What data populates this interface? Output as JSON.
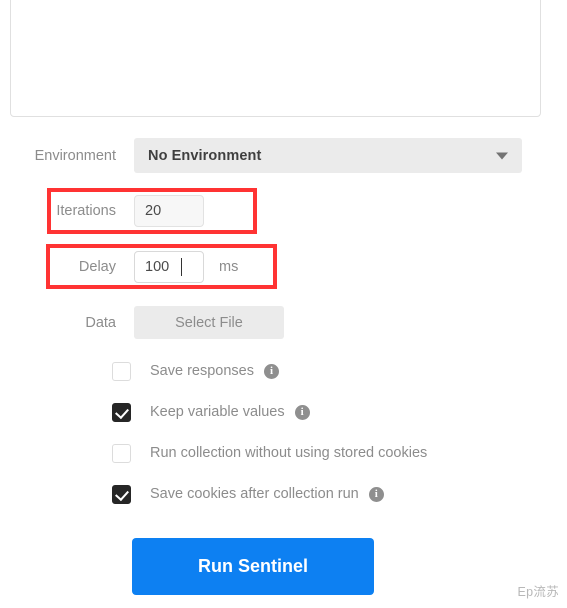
{
  "panel": {
    "preview_area_placeholder": ""
  },
  "form": {
    "environment": {
      "label": "Environment",
      "selected": "No Environment",
      "chevron_icon": "chevron-down-icon"
    },
    "iterations": {
      "label": "Iterations",
      "value": "20"
    },
    "delay": {
      "label": "Delay",
      "value": "100",
      "unit": "ms"
    },
    "data": {
      "label": "Data",
      "button_label": "Select File"
    }
  },
  "options": [
    {
      "label": "Save responses",
      "checked": false,
      "has_info_icon": true,
      "info_icon": "info-icon"
    },
    {
      "label": "Keep variable values",
      "checked": true,
      "has_info_icon": true,
      "info_icon": "info-icon"
    },
    {
      "label": "Run collection without using stored cookies",
      "checked": false,
      "has_info_icon": false,
      "info_icon": ""
    },
    {
      "label": "Save cookies after collection run",
      "checked": true,
      "has_info_icon": true,
      "info_icon": "info-icon"
    }
  ],
  "run_button": {
    "label": "Run Sentinel"
  },
  "watermark": {
    "text": "Ep流苏"
  },
  "colors": {
    "accent_blue": "#0d80f2",
    "annotation_red": "#ff3333",
    "checkbox_checked": "#262626",
    "field_gray": "#ebebeb",
    "label_gray": "#8c8c8c"
  }
}
